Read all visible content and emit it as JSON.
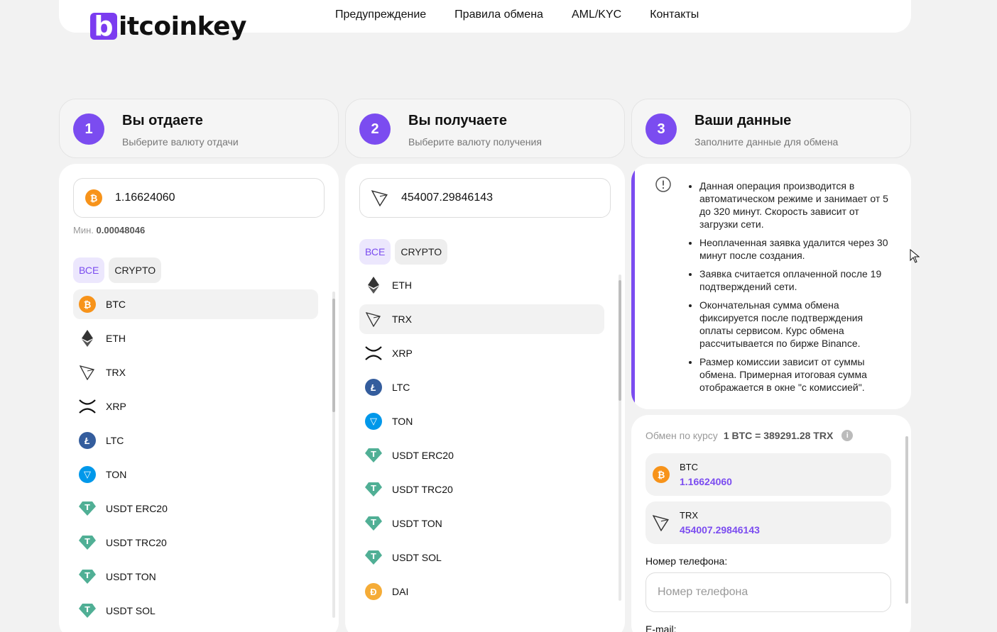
{
  "header": {
    "logo_b": "b",
    "logo_text": "itcoinkey",
    "nav": [
      "Предупреждение",
      "Правила обмена",
      "AML/KYC",
      "Контакты"
    ]
  },
  "steps": [
    {
      "num": "1",
      "title": "Вы отдаете",
      "subtitle": "Выберите валюту отдачи"
    },
    {
      "num": "2",
      "title": "Вы получаете",
      "subtitle": "Выберите валюту получения"
    },
    {
      "num": "3",
      "title": "Ваши данные",
      "subtitle": "Заполните данные для обмена"
    }
  ],
  "give": {
    "amount": "1.16624060",
    "min_label": "Мин.",
    "min_value": "0.00048046",
    "filters": [
      "ВСЕ",
      "CRYPTO"
    ],
    "items": [
      "BTC",
      "ETH",
      "TRX",
      "XRP",
      "LTC",
      "TON",
      "USDT ERC20",
      "USDT TRC20",
      "USDT TON",
      "USDT SOL"
    ],
    "selected": "BTC"
  },
  "receive": {
    "amount": "454007.29846143",
    "filters": [
      "ВСЕ",
      "CRYPTO"
    ],
    "items": [
      "ETH",
      "TRX",
      "XRP",
      "LTC",
      "TON",
      "USDT ERC20",
      "USDT TRC20",
      "USDT TON",
      "USDT SOL",
      "DAI"
    ],
    "selected": "TRX"
  },
  "info": {
    "notes": [
      "Данная операция производится в автоматическом режиме и занимает от 5 до 320 минут. Скорость зависит от загрузки сети.",
      "Неоплаченная заявка удалится через 30 минут после создания.",
      "Заявка считается оплаченной после 19 подтверждений сети.",
      "Окончательная сумма обмена фиксируется после подтверждения оплаты сервисом. Курс обмена рассчитывается по бирже Binance.",
      "Размер комиссии зависит от суммы обмена. Примерная итоговая сумма отображается в окне \"с комиссией\"."
    ]
  },
  "exchange": {
    "rate_label": "Обмен по курсу",
    "rate_value": "1 BTC = 389291.28 TRX",
    "rate_help": "i",
    "from_currency": "BTC",
    "from_amount": "1.16624060",
    "to_currency": "TRX",
    "to_amount": "454007.29846143",
    "phone_label": "Номер телефона:",
    "phone_placeholder": "Номер телефона",
    "email_label": "E-mail:"
  },
  "colors": {
    "accent": "#7b4cf0",
    "btc": "#f7931a",
    "ltc": "#345d9d",
    "ton": "#0098ea",
    "usdt": "#50af95",
    "dai": "#f5ac37"
  }
}
